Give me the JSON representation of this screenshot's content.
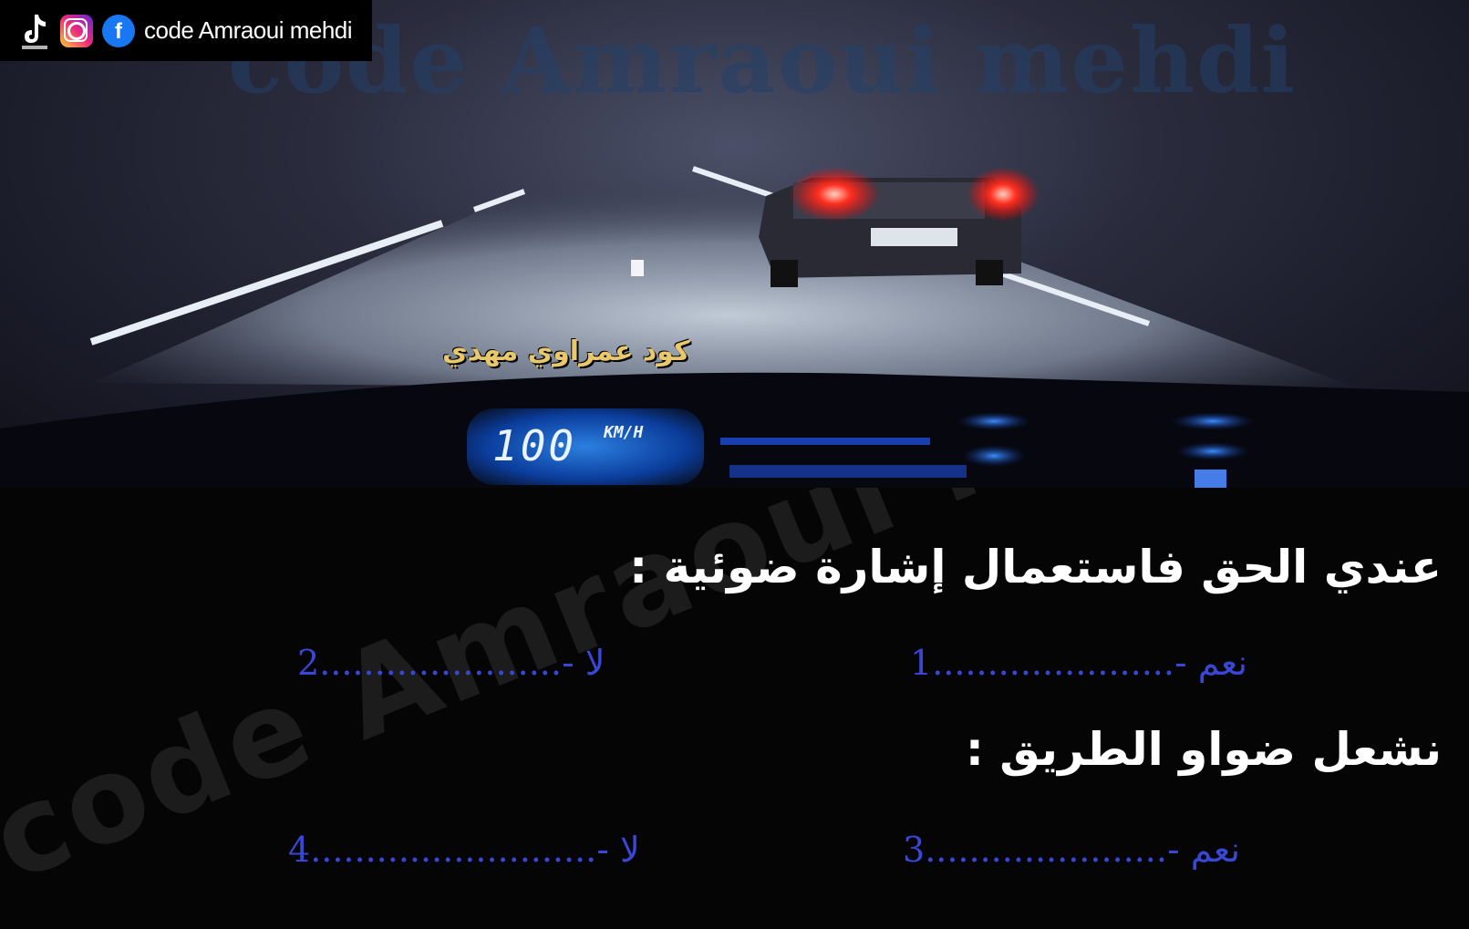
{
  "watermark": {
    "top": "code Amraoui mehdi",
    "diagonal": "code Amraoui mehdi"
  },
  "social": {
    "handle": "code Amraoui mehdi",
    "icons": [
      "tiktok-icon",
      "instagram-icon",
      "facebook-icon"
    ]
  },
  "overlay_text": "كود عمراوي مهدي",
  "dashboard": {
    "speed": "100",
    "unit": "KM/H"
  },
  "questions": [
    {
      "text": "عندي الحق فاستعمال إشارة ضوئية :",
      "answers": [
        {
          "number": "1",
          "dots": "......................",
          "label": "نعم -"
        },
        {
          "number": "2",
          "dots": "......................",
          "label": "لا -"
        }
      ]
    },
    {
      "text": "نشعل ضواو الطريق :",
      "answers": [
        {
          "number": "3",
          "dots": "......................",
          "label": "نعم -"
        },
        {
          "number": "4",
          "dots": "..........................",
          "label": "لا -"
        }
      ]
    }
  ],
  "colors": {
    "answer": "#3a47d6",
    "overlay": "#e9c86a",
    "question": "#ffffff"
  }
}
